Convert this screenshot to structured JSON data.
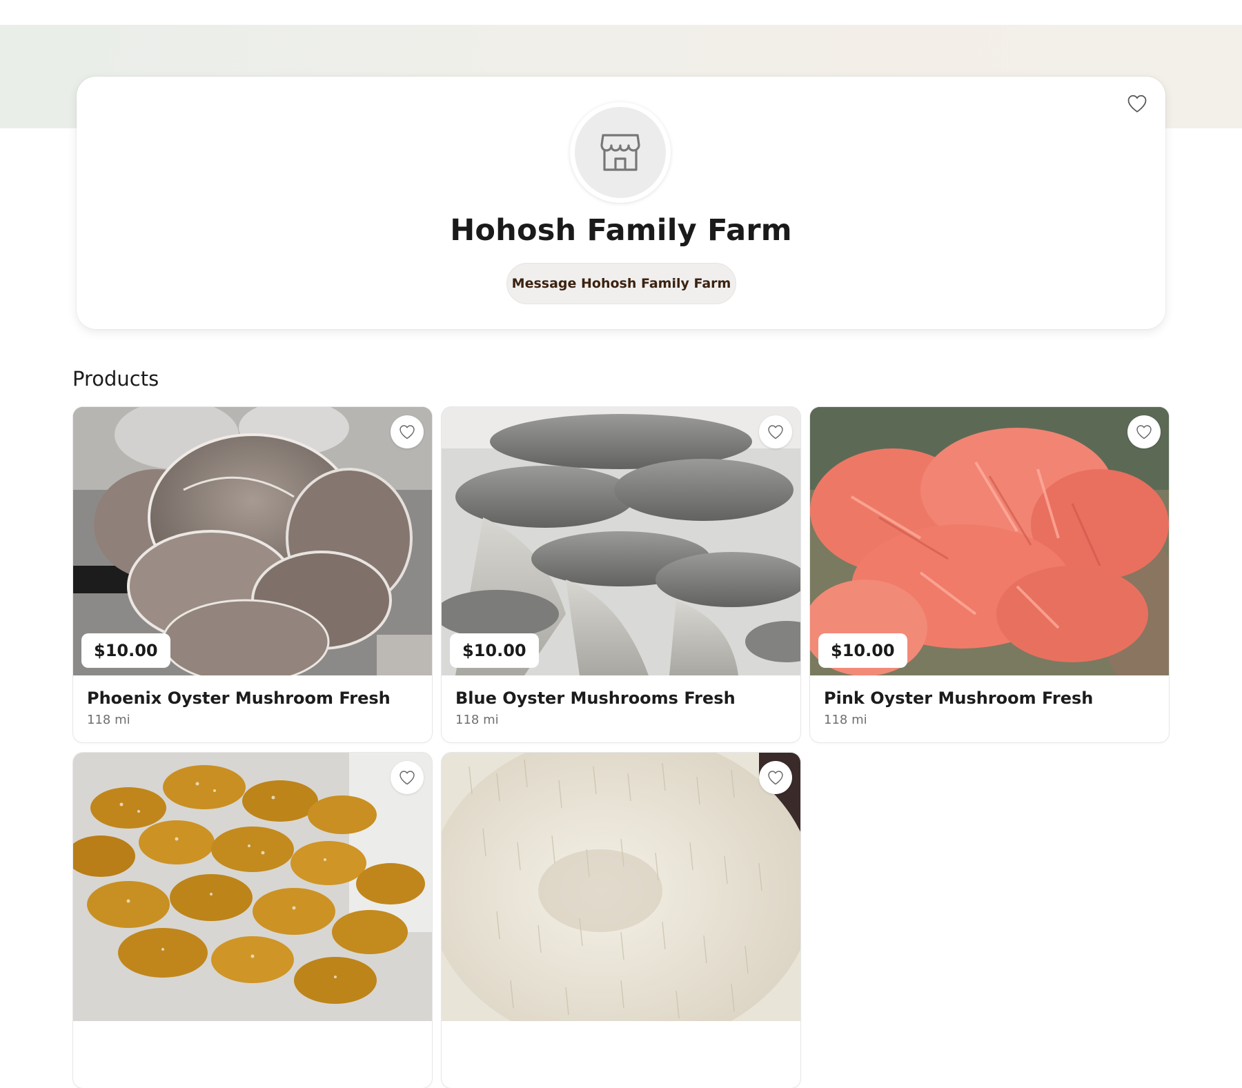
{
  "store": {
    "name": "Hohosh Family Farm",
    "message_label": "Message Hohosh Family Farm",
    "avatar_icon": "storefront-icon",
    "favorite_icon": "heart-outline-icon"
  },
  "products_section": {
    "title": "Products"
  },
  "products": [
    {
      "title": "Phoenix Oyster Mushroom Fresh",
      "price": "$10.00",
      "distance": "118 mi",
      "image": "phoenix-oyster-mushroom-photo"
    },
    {
      "title": "Blue Oyster Mushrooms Fresh",
      "price": "$10.00",
      "distance": "118 mi",
      "image": "blue-oyster-mushroom-photo"
    },
    {
      "title": "Pink Oyster Mushroom Fresh",
      "price": "$10.00",
      "distance": "118 mi",
      "image": "pink-oyster-mushroom-photo"
    },
    {
      "image": "chestnut-mushroom-cluster-photo"
    },
    {
      "image": "lions-mane-mushroom-photo"
    }
  ],
  "colors": {
    "message_text": "#3b2210",
    "banner": "#eef0ea"
  }
}
